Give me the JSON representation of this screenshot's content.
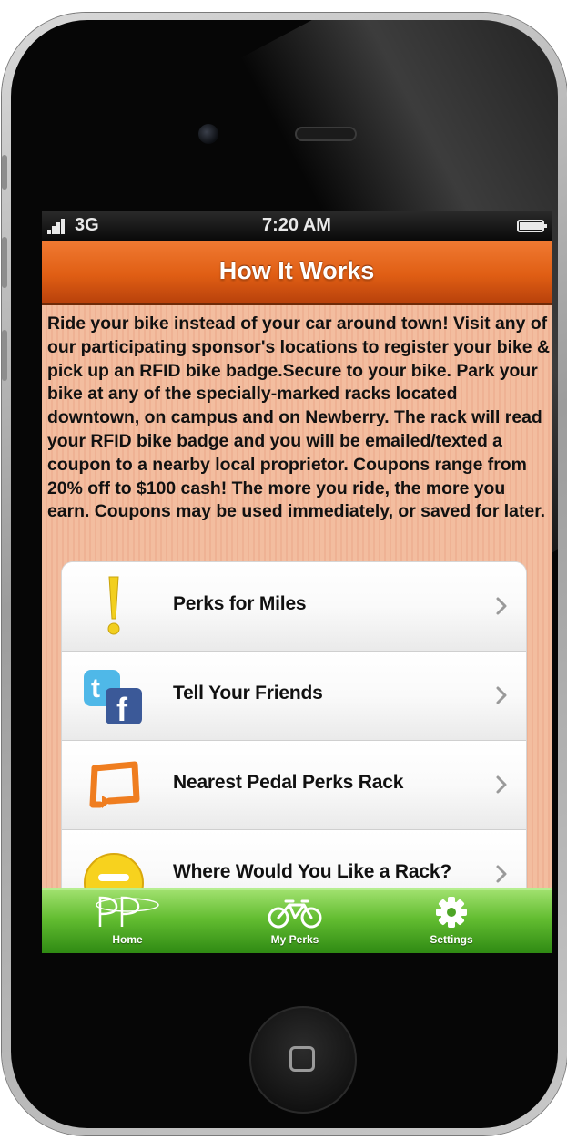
{
  "status_bar": {
    "network": "3G",
    "time": "7:20 AM"
  },
  "header": {
    "title": "How It Works"
  },
  "description": "Ride your bike instead of your car around town! Visit any of our participating sponsor's locations to register your bike & pick up an RFID bike badge.Secure to your bike. Park your bike at any of the specially-marked racks located downtown, on campus and on Newberry. The rack will read your RFID bike badge and you will be emailed/texted a coupon to a nearby local proprietor. Coupons range from 20% off to $100 cash! The more you ride, the more you earn. Coupons may be used immediately, or saved for later.",
  "menu": {
    "items": [
      {
        "label": "Perks for Miles",
        "icon": "exclamation-icon"
      },
      {
        "label": "Tell Your Friends",
        "icon": "twitter-facebook-icon"
      },
      {
        "label": "Nearest Pedal Perks Rack",
        "icon": "rack-icon"
      },
      {
        "label": "Where Would You Like a Rack?",
        "icon": "smiley-icon"
      }
    ]
  },
  "tab_bar": {
    "tabs": [
      {
        "label": "Home",
        "icon": "pedal-perks-logo-icon"
      },
      {
        "label": "My Perks",
        "icon": "bicycle-icon"
      },
      {
        "label": "Settings",
        "icon": "gear-icon"
      }
    ]
  },
  "colors": {
    "header_orange": "#e05e14",
    "content_peach": "#f3bd9f",
    "tab_green": "#63bd31",
    "status_black": "#0a0a0a"
  }
}
